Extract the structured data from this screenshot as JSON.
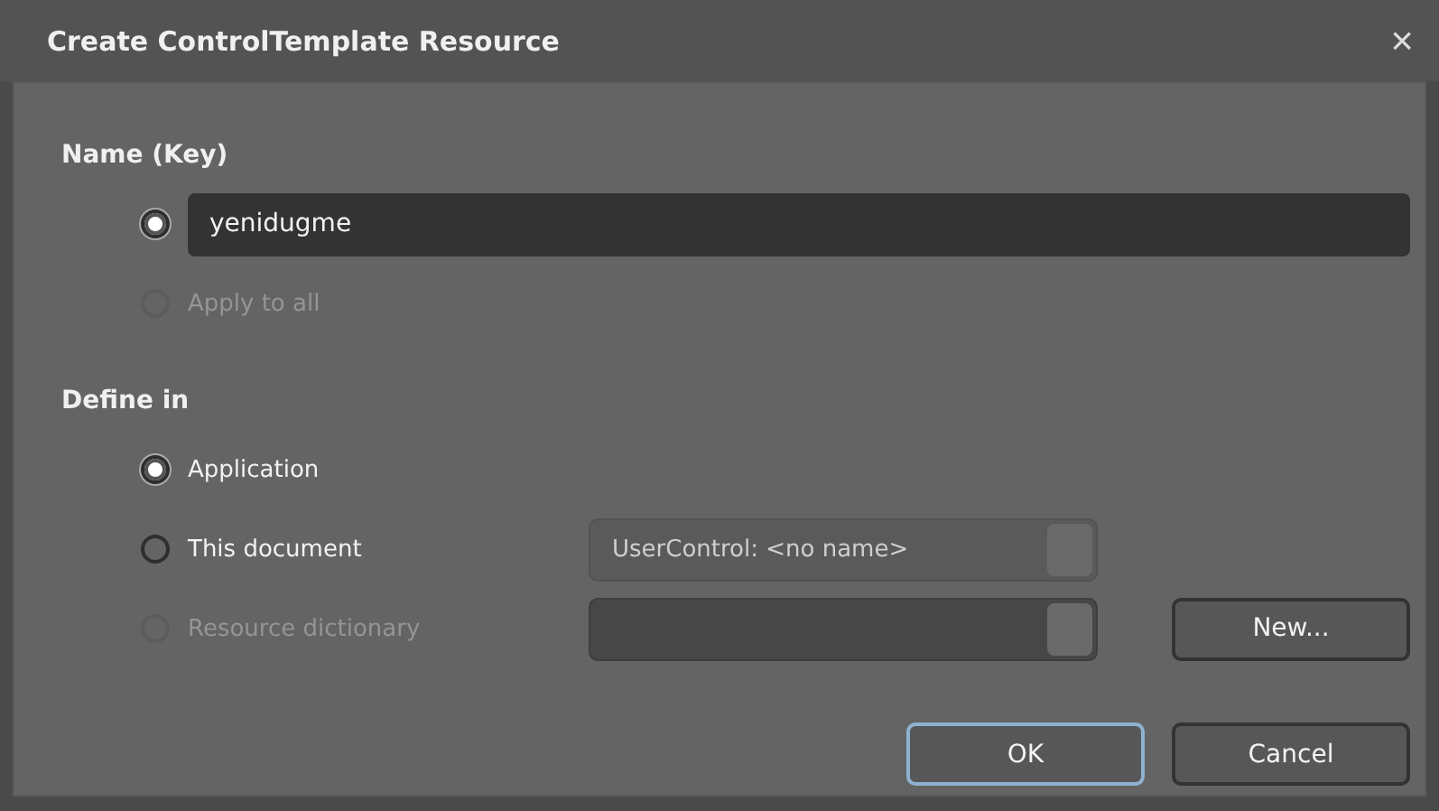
{
  "window": {
    "title": "Create ControlTemplate Resource",
    "close": "×"
  },
  "name_section": {
    "heading": "Name (Key)",
    "options": [
      {
        "kind": "text",
        "selected": true,
        "disabled": false,
        "value": "yenidugme"
      },
      {
        "kind": "label",
        "selected": false,
        "disabled": true,
        "label": "Apply to all"
      }
    ]
  },
  "define_in": {
    "heading": "Define in",
    "options": [
      {
        "label": "Application",
        "selected": true,
        "disabled": false
      },
      {
        "label": "This document",
        "selected": false,
        "disabled": false,
        "combo": {
          "disabled": false,
          "value": "UserControl: <no name>"
        }
      },
      {
        "label": "Resource dictionary",
        "selected": false,
        "disabled": true,
        "combo": {
          "disabled": true
        },
        "button": "New..."
      }
    ]
  },
  "buttons": [
    {
      "label": "OK",
      "focused": true
    },
    {
      "label": "Cancel",
      "focused": false
    }
  ]
}
